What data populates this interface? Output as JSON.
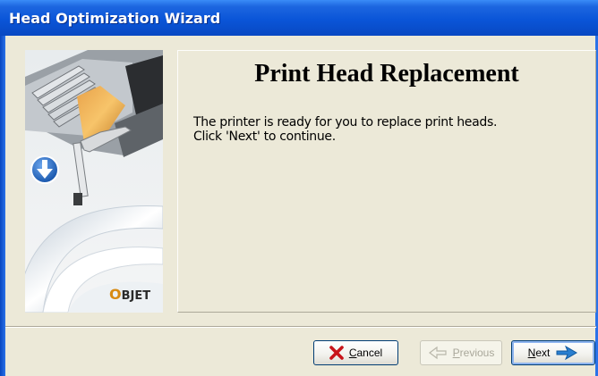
{
  "window": {
    "title": "Head Optimization Wizard"
  },
  "page": {
    "heading": "Print Head Replacement",
    "message_line1": "The printer is ready for you to replace print heads.",
    "message_line2": "Click 'Next' to continue."
  },
  "image_panel": {
    "logo_text": "OBJET",
    "logo_letter": "O",
    "logo_rest": "BJET"
  },
  "buttons": {
    "cancel": {
      "label": "Cancel",
      "enabled": true
    },
    "previous": {
      "label": "Previous",
      "enabled": false
    },
    "next": {
      "label": "Next",
      "enabled": true,
      "default": true
    }
  },
  "colors": {
    "titlebar": "#0a55d8",
    "dialog_bg": "#ece9d8",
    "cancel_icon": "#c8141a",
    "next_arrow": "#2a7fd0",
    "download_icon": "#1a5fb8"
  },
  "icons": {
    "cancel": "x-icon",
    "previous": "arrow-left-icon",
    "next": "arrow-right-icon",
    "image": "download-arrow-icon"
  }
}
